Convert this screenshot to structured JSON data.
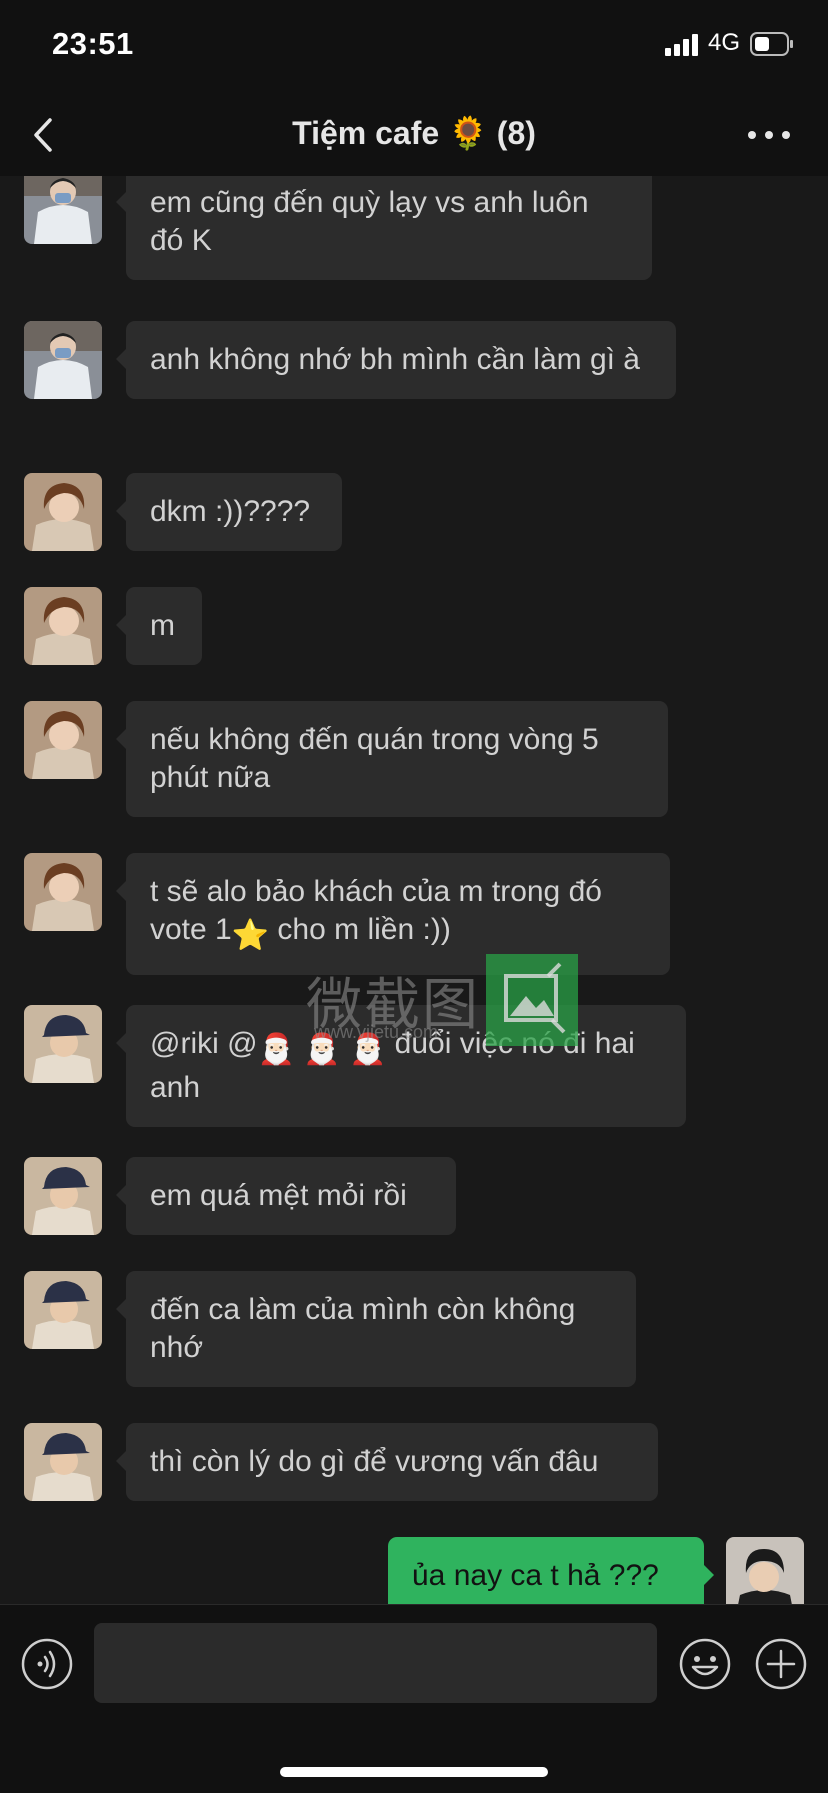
{
  "status_bar": {
    "time": "23:51",
    "network": "4G"
  },
  "header": {
    "title": "Tiệm cafe 🌻 (8)"
  },
  "messages": [
    {
      "text": "em cũng đến quỳ lạy vs anh luôn đó K"
    },
    {
      "text": "anh không nhớ bh mình cần làm gì à"
    },
    {
      "text": "dkm :))????"
    },
    {
      "text": "m"
    },
    {
      "text": "nếu không đến quán trong vòng 5 phút nữa"
    },
    {
      "text_before": "t sẽ alo bảo khách của m trong đó vote 1",
      "emoji": "⭐",
      "text_after": " cho m liền :))"
    },
    {
      "text_before": "@riki @",
      "emojis": "🎅🏻 🎅🏻 🎅🏻",
      "text_after": " đuổi việc nó đi hai anh"
    },
    {
      "text": "em quá mệt mỏi rồi"
    },
    {
      "text": "đến ca làm của mình còn không nhớ"
    },
    {
      "text": "thì còn lý do gì để vương vấn đâu"
    },
    {
      "text": "ủa nay ca t hả ???"
    }
  ],
  "watermark": {
    "text": "微截图",
    "url": "www.vjietu.com"
  },
  "input": {
    "placeholder": ""
  },
  "colors": {
    "background": "#191919",
    "bubble_other": "#2c2c2c",
    "bubble_self": "#2fb35e",
    "bar": "#111111"
  },
  "icons": [
    "back-icon",
    "more-icon",
    "voice-icon",
    "emoji-icon",
    "plus-icon",
    "signal-icon",
    "battery-icon"
  ]
}
